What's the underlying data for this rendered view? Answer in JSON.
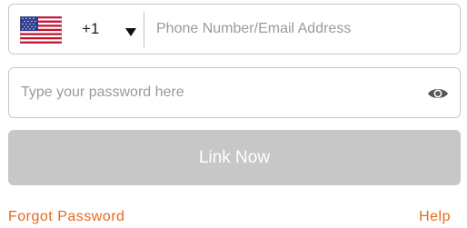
{
  "phone": {
    "flag_icon": "us-flag-icon",
    "country_code": "+1",
    "dropdown_icon": "caret-down-icon",
    "placeholder": "Phone Number/Email Address",
    "value": ""
  },
  "password": {
    "placeholder": "Type your password here",
    "value": "",
    "toggle_icon": "eye-icon"
  },
  "actions": {
    "link_now_label": "Link Now",
    "forgot_password_label": "Forgot Password",
    "help_label": "Help"
  },
  "colors": {
    "accent": "#e8691c",
    "button_disabled_bg": "#c7c7c7",
    "border": "#c8c8c8",
    "placeholder": "#9a9a9a"
  }
}
